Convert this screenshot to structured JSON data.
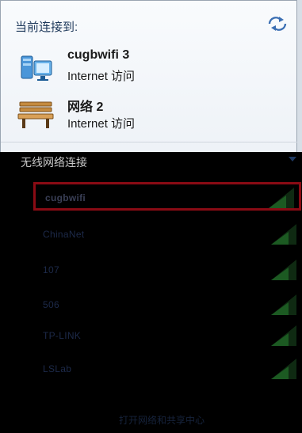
{
  "header": {
    "title": "当前连接到:"
  },
  "connected": [
    {
      "name": "cugbwifi  3",
      "access": "Internet 访问",
      "icon": "computer-network-icon"
    },
    {
      "name": "网络  2",
      "access": "Internet 访问",
      "icon": "park-bench-icon"
    }
  ],
  "wireless": {
    "section_title": "无线网络连接",
    "networks": [
      {
        "ssid": "cugbwifi",
        "selected": true
      },
      {
        "ssid": "ChinaNet"
      },
      {
        "ssid": "107"
      },
      {
        "ssid": "506"
      },
      {
        "ssid": "TP-LINK"
      },
      {
        "ssid": "LSLab"
      }
    ]
  },
  "footer": {
    "open_center": "打开网络和共享中心"
  },
  "colors": {
    "panel_bg": "#f4f7fa",
    "header_text": "#1e395b",
    "selected_border": "#8a0b14",
    "dark_bg": "#000000"
  }
}
